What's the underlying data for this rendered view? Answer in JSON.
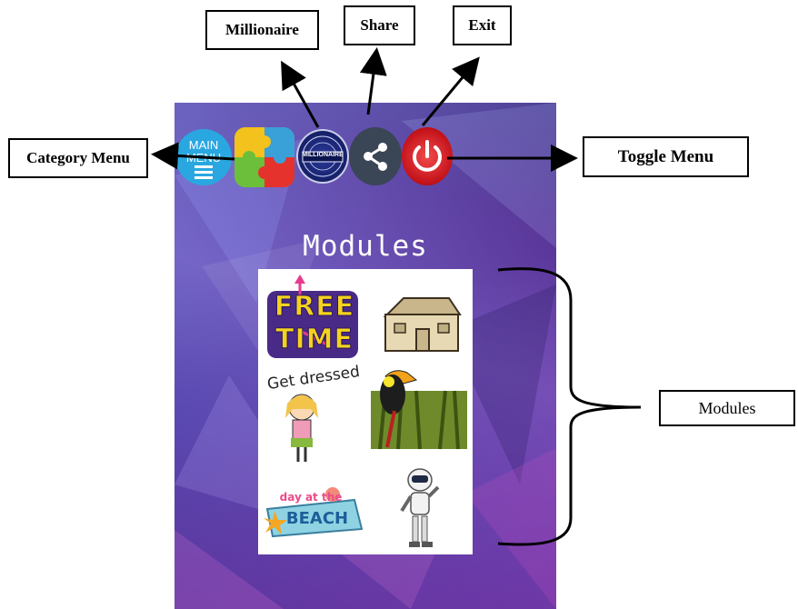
{
  "annotations": {
    "category_menu": "Category Menu",
    "millionaire": "Millionaire",
    "share": "Share",
    "exit": "Exit",
    "toggle_menu": "Toggle Menu",
    "modules": "Modules"
  },
  "app": {
    "title": "Modules",
    "main_menu_button": {
      "line1": "MAIN",
      "line2": "MENU"
    },
    "millionaire_logo_text": "MILLIONAIRE",
    "icons": [
      "menu-icon",
      "puzzle-icon",
      "millionaire-logo-icon",
      "share-icon",
      "power-icon"
    ],
    "modules": [
      {
        "id": "free-time",
        "text_line1": "FREE",
        "text_line2": "TIME"
      },
      {
        "id": "house"
      },
      {
        "id": "get-dressed",
        "text": "Get dressed"
      },
      {
        "id": "toucan"
      },
      {
        "id": "day-at-the-beach",
        "text_line1": "day at the",
        "text_line2": "BEACH"
      },
      {
        "id": "robot"
      }
    ]
  },
  "colors": {
    "main_menu": "#2aa7e0",
    "share_button": "#3a4556",
    "power_button": "#d6191f",
    "free_time_yellow": "#f4d21f",
    "free_time_purple": "#4a2a87"
  }
}
